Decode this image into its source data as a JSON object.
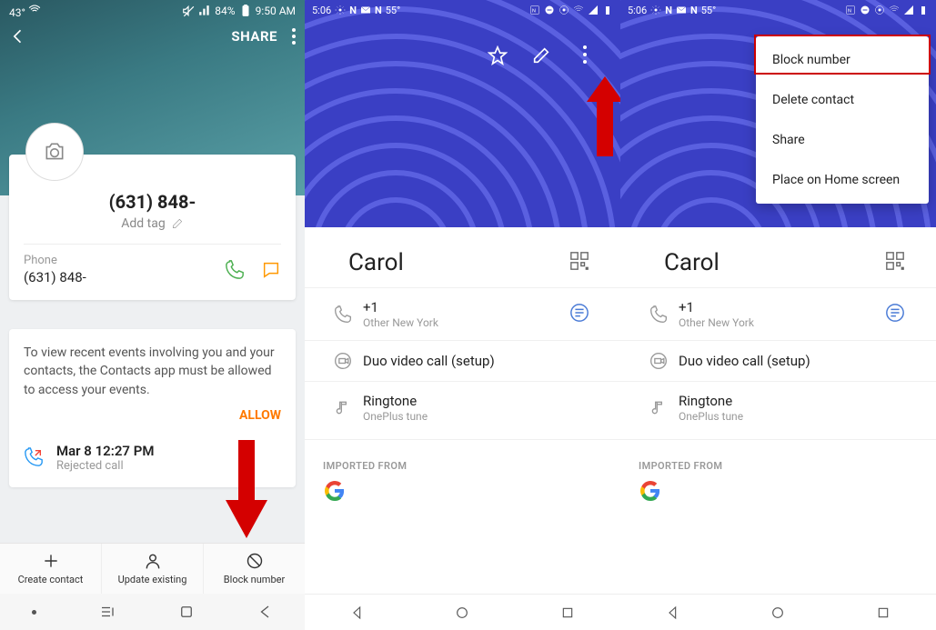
{
  "panel1": {
    "status": {
      "temp": "43°",
      "battery_pct": "84%",
      "time": "9:50 AM"
    },
    "share_label": "SHARE",
    "contact_number": "(631) 848-",
    "add_tag_label": "Add tag",
    "phone_label": "Phone",
    "phone_value": "(631) 848-",
    "events_text": "To view recent events involving you and your contacts, the Contacts app must be allowed to access your events.",
    "allow_label": "ALLOW",
    "call_time": "Mar 8 12:27 PM",
    "call_status": "Rejected call",
    "bottom": {
      "create": "Create contact",
      "update": "Update existing",
      "block": "Block number"
    }
  },
  "panel2": {
    "status": {
      "time": "5:06",
      "temp": "55°"
    },
    "contact_name": "Carol",
    "phone_title": "+1",
    "phone_sub": "Other New York",
    "duo_label": "Duo video call (setup)",
    "ringtone_label": "Ringtone",
    "ringtone_value": "OnePlus tune",
    "imported_label": "IMPORTED FROM"
  },
  "panel3": {
    "status": {
      "time": "5:06",
      "temp": "55°"
    },
    "contact_name": "Carol",
    "phone_title": "+1",
    "phone_sub": "Other New York",
    "duo_label": "Duo video call (setup)",
    "ringtone_label": "Ringtone",
    "ringtone_value": "OnePlus tune",
    "imported_label": "IMPORTED FROM",
    "menu": {
      "block": "Block number",
      "delete": "Delete contact",
      "share": "Share",
      "home": "Place on Home screen"
    }
  }
}
